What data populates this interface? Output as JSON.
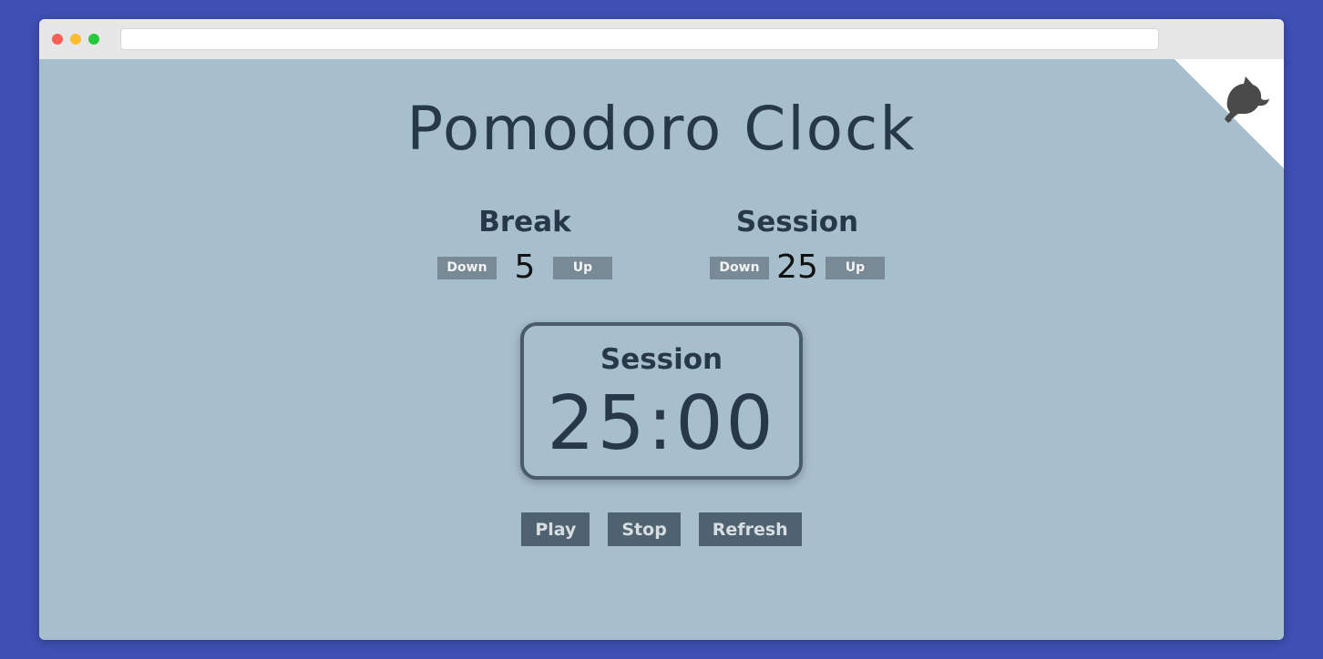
{
  "app": {
    "title": "Pomodoro Clock"
  },
  "controls": {
    "break": {
      "label": "Break",
      "down_label": "Down",
      "value": "5",
      "up_label": "Up"
    },
    "session": {
      "label": "Session",
      "down_label": "Down",
      "value": "25",
      "up_label": "Up"
    }
  },
  "clock": {
    "mode_label": "Session",
    "time": "25:00"
  },
  "actions": {
    "play_label": "Play",
    "stop_label": "Stop",
    "refresh_label": "Refresh"
  },
  "icons": {
    "corner": "github-octocat-icon"
  },
  "colors": {
    "page_background": "#3f4fb3",
    "app_background": "#a7bfcc",
    "text_dark": "#263849",
    "small_button": "#778a95",
    "action_button": "#4e6270",
    "clock_border": "#4a5b6c"
  }
}
